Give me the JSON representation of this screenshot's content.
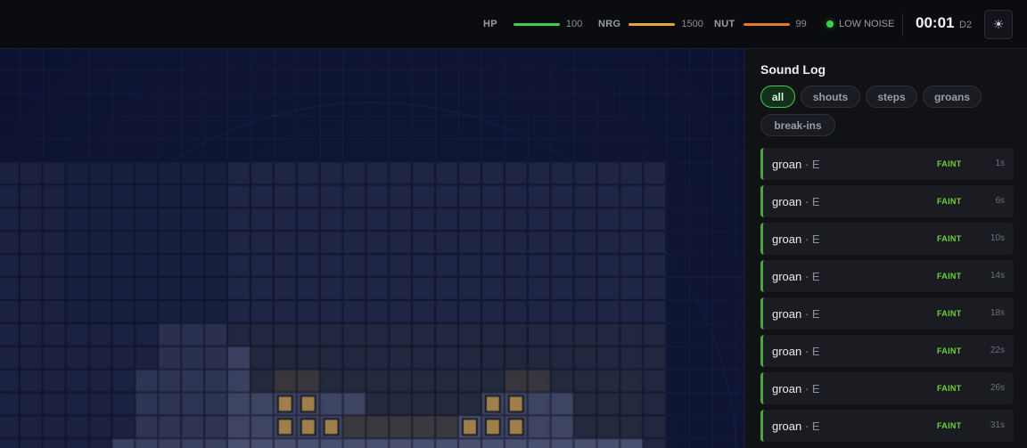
{
  "hud": {
    "stats": [
      {
        "label": "HP",
        "value": "100",
        "fraction": 1.0,
        "color": "#3ecf4a"
      },
      {
        "label": "NRG",
        "value": "1500",
        "fraction": 1.0,
        "color": "#e8a23a"
      },
      {
        "label": "NUT",
        "value": "99",
        "fraction": 0.99,
        "color": "#e07a2a"
      }
    ],
    "noise": "LOW NOISE",
    "noise_color": "#3ecf4a",
    "clock": "00:01",
    "day": "D2",
    "theme_icon": "sun-icon"
  },
  "sound_log": {
    "title": "Sound Log",
    "filters": [
      {
        "label": "all",
        "active": true
      },
      {
        "label": "shouts",
        "active": false
      },
      {
        "label": "steps",
        "active": false
      },
      {
        "label": "groans",
        "active": false
      },
      {
        "label": "break-ins",
        "active": false
      }
    ],
    "entries": [
      {
        "type": "groan",
        "dir": "E",
        "level": "FAINT",
        "age": "1s"
      },
      {
        "type": "groan",
        "dir": "E",
        "level": "FAINT",
        "age": "6s"
      },
      {
        "type": "groan",
        "dir": "E",
        "level": "FAINT",
        "age": "10s"
      },
      {
        "type": "groan",
        "dir": "E",
        "level": "FAINT",
        "age": "14s"
      },
      {
        "type": "groan",
        "dir": "E",
        "level": "FAINT",
        "age": "18s"
      },
      {
        "type": "groan",
        "dir": "E",
        "level": "FAINT",
        "age": "22s"
      },
      {
        "type": "groan",
        "dir": "E",
        "level": "FAINT",
        "age": "26s"
      },
      {
        "type": "groan",
        "dir": "E",
        "level": "FAINT",
        "age": "31s"
      }
    ]
  },
  "colors": {
    "accent": "#3ecf4a",
    "player": "#3fa05a",
    "enemy": "#a83a38",
    "crate": "#a0804a",
    "faint": "#6fcf3a"
  }
}
